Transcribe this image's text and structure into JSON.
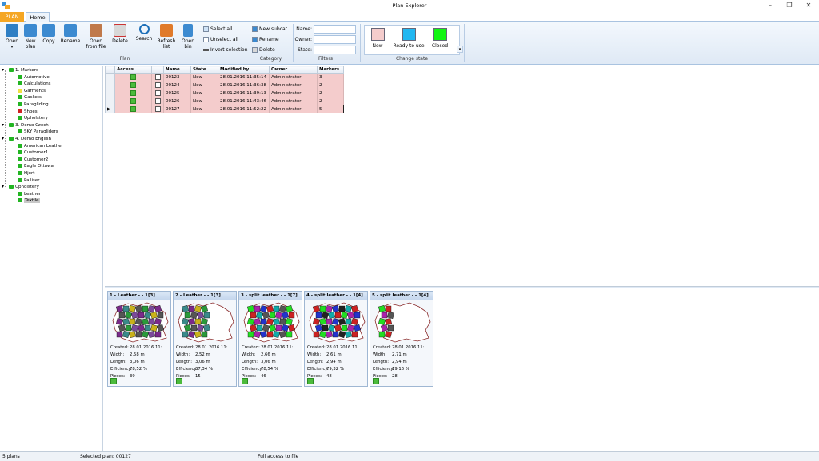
{
  "window": {
    "title": "Plan Explorer"
  },
  "tabs": {
    "plan": "PLAN",
    "home": "Home"
  },
  "ribbon": {
    "plan_group": {
      "label": "Plan",
      "buttons": [
        {
          "label": "Open\n▾",
          "icon": "folder-open-icon"
        },
        {
          "label": "New\nplan",
          "icon": "new-plan-icon"
        },
        {
          "label": "Copy",
          "icon": "copy-icon"
        },
        {
          "label": "Rename",
          "icon": "rename-icon"
        },
        {
          "label": "Open\nfrom file",
          "icon": "open-file-icon"
        },
        {
          "label": "Delete",
          "icon": "delete-icon"
        },
        {
          "label": "Search",
          "icon": "search-icon"
        },
        {
          "label": "Refresh\nlist",
          "icon": "refresh-icon"
        },
        {
          "label": "Open\nbin",
          "icon": "bin-icon"
        }
      ],
      "select_all": "Select all",
      "unselect_all": "Unselect all",
      "invert_selection": "Invert selection"
    },
    "category_group": {
      "label": "Category",
      "new_subcat": "New subcat.",
      "rename": "Rename",
      "delete": "Delete"
    },
    "filters_group": {
      "label": "Filters",
      "name_label": "Name:",
      "owner_label": "Owner:",
      "state_label": "State:"
    },
    "state_group": {
      "label": "Change state",
      "states": [
        {
          "label": "New",
          "color": "#f4cccc"
        },
        {
          "label": "Ready to use",
          "color": "#21b7f1"
        },
        {
          "label": "Closed",
          "color": "#12f512"
        }
      ]
    }
  },
  "tree": [
    {
      "label": "1. Markers",
      "level": 0,
      "expander": "▾"
    },
    {
      "label": "Automotive",
      "level": 1
    },
    {
      "label": "Calculations",
      "level": 1
    },
    {
      "label": "Garments",
      "level": 1,
      "color": "#f0e040"
    },
    {
      "label": "Gaskets",
      "level": 1
    },
    {
      "label": "Paragliding",
      "level": 1
    },
    {
      "label": "Shoes",
      "level": 1,
      "color": "#d02020"
    },
    {
      "label": "Upholstery",
      "level": 1
    },
    {
      "label": "3. Demo Czech",
      "level": 0,
      "expander": "▾"
    },
    {
      "label": "SKY Paragliders",
      "level": 1
    },
    {
      "label": "4. Demo English",
      "level": 0,
      "expander": "▾"
    },
    {
      "label": "American Leather",
      "level": 1
    },
    {
      "label": "Customer1",
      "level": 1
    },
    {
      "label": "Customer2",
      "level": 1
    },
    {
      "label": "Eagle Ottawa",
      "level": 1
    },
    {
      "label": "Hjort",
      "level": 1
    },
    {
      "label": "Palliser",
      "level": 1
    },
    {
      "label": "Upholstery",
      "level": 0,
      "expander": "▾"
    },
    {
      "label": "Leather",
      "level": 1
    },
    {
      "label": "Textile",
      "level": 1,
      "selected": true
    }
  ],
  "grid": {
    "columns": [
      "Access",
      "",
      "Name",
      "State",
      "Modified by",
      "Owner",
      "Markers"
    ],
    "rows": [
      {
        "name": "00123",
        "state": "New",
        "modified": "28.01.2016 11:35:14",
        "owner": "Administrator",
        "markers": "3"
      },
      {
        "name": "00124",
        "state": "New",
        "modified": "28.01.2016 11:36:38",
        "owner": "Administrator",
        "markers": "2"
      },
      {
        "name": "00125",
        "state": "New",
        "modified": "28.01.2016 11:39:13",
        "owner": "Administrator",
        "markers": "2"
      },
      {
        "name": "00126",
        "state": "New",
        "modified": "28.01.2016 11:43:46",
        "owner": "Administrator",
        "markers": "2"
      },
      {
        "name": "00127",
        "state": "New",
        "modified": "28.01.2016 11:52:22",
        "owner": "Administrator",
        "markers": "5",
        "current": true
      }
    ]
  },
  "markers": [
    {
      "title": "1 - Leather -   - 1[3]",
      "created": "28.01.2016 11:...",
      "width": "2,58 m",
      "length": "3,06 m",
      "efficiency": "78,52 %",
      "pieces": "39"
    },
    {
      "title": "2 - Leather -   - 1[3]",
      "created": "28.01.2016 11:...",
      "width": "2,52 m",
      "length": "3,06 m",
      "efficiency": "37,34 %",
      "pieces": "15"
    },
    {
      "title": "3 - split leather -   - 1[7]",
      "created": "28.01.2016 11:...",
      "width": "2,66 m",
      "length": "3,06 m",
      "efficiency": "78,54 %",
      "pieces": "46"
    },
    {
      "title": "4 - split leather -   - 1[4]",
      "created": "28.01.2016 11:...",
      "width": "2,61 m",
      "length": "2,94 m",
      "efficiency": "79,32 %",
      "pieces": "48"
    },
    {
      "title": "5 - split leather -   - 1[4]",
      "created": "28.01.2016 11:...",
      "width": "2,71 m",
      "length": "2,94 m",
      "efficiency": "19,16 %",
      "pieces": "28"
    }
  ],
  "marker_labels": {
    "created": "Created:",
    "width": "Width:",
    "length": "Length:",
    "efficiency": "Efficiency:",
    "pieces": "Pieces:"
  },
  "status": {
    "plans": "5 plans",
    "selected": "Selected plan:  00127",
    "access": "Full access to file"
  }
}
